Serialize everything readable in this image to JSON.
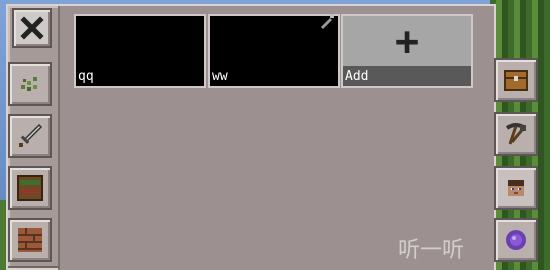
{
  "slots": [
    {
      "label": "qq"
    },
    {
      "label": "ww"
    }
  ],
  "add_slot": {
    "label": "Add"
  },
  "icons": {
    "close": "close-icon",
    "left_tabs": [
      "leaf-icon",
      "sword-icon",
      "bookshelf-block-icon",
      "brick-block-icon"
    ],
    "right_tabs": [
      "chest-icon",
      "pickaxe-shovel-icon",
      "steve-head-icon",
      "ender-pearl-icon"
    ]
  },
  "colors": {
    "panel": "#a59a98",
    "slot": "#000000",
    "add_slot": "#a6a6a6"
  },
  "watermark": "听一听"
}
